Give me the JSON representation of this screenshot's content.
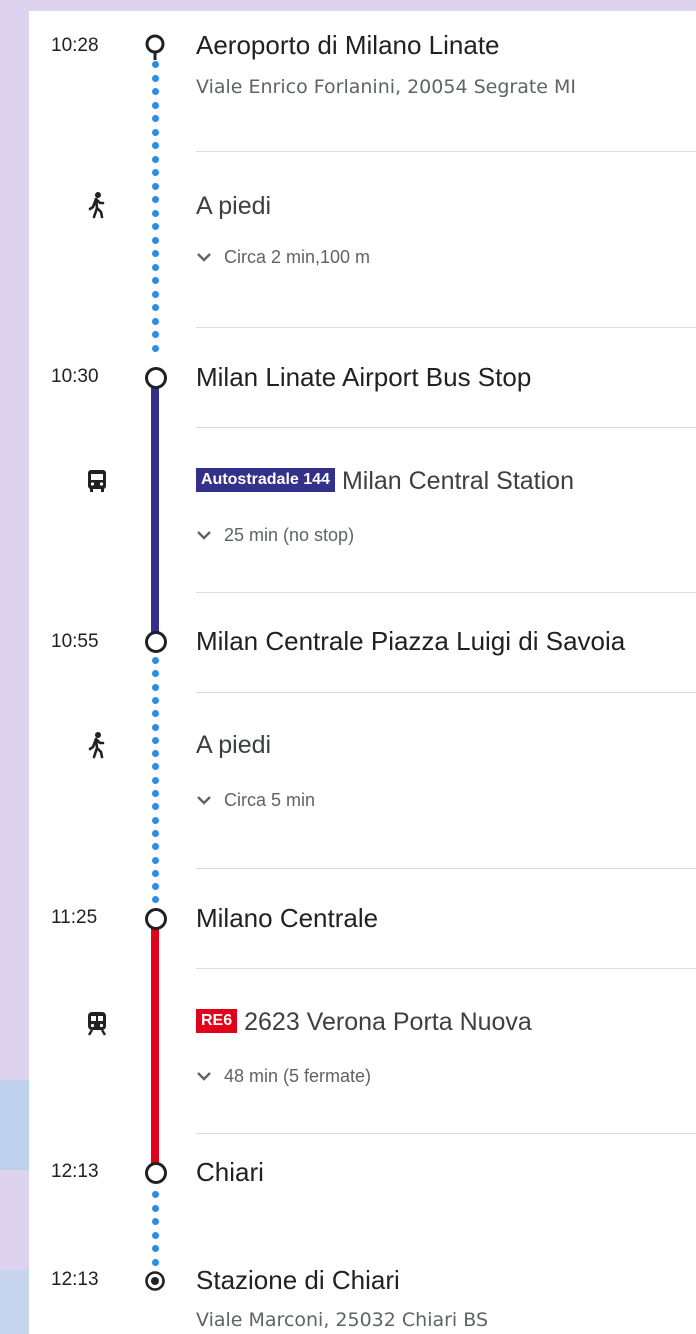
{
  "colors": {
    "walk_dots": "#2b8ce6",
    "bus_line": "#33318a",
    "train_line": "#e3001b",
    "bus_badge": "#33318a",
    "train_badge": "#e3001b"
  },
  "itinerary": {
    "stops": [
      {
        "time": "10:28",
        "name": "Aeroporto di Milano Linate",
        "address": "Viale Enrico Forlanini, 20054 Segrate MI"
      },
      {
        "time": "10:30",
        "name": "Milan Linate Airport Bus Stop"
      },
      {
        "time": "10:55",
        "name": "Milan Centrale Piazza Luigi di Savoia"
      },
      {
        "time": "11:25",
        "name": "Milano Centrale"
      },
      {
        "time": "12:13",
        "name": "Chiari"
      },
      {
        "time": "12:13",
        "name": "Stazione di Chiari",
        "address": "Viale Marconi, 25032 Chiari BS"
      }
    ],
    "segments": [
      {
        "mode_icon": "walk-icon",
        "label": "A piedi",
        "detail": "Circa 2 min,100 m"
      },
      {
        "mode_icon": "bus-icon",
        "badge": "Autostradale 144",
        "label": "Milan Central Station",
        "detail": "25 min (no stop)"
      },
      {
        "mode_icon": "walk-icon",
        "label": "A piedi",
        "detail": "Circa 5 min"
      },
      {
        "mode_icon": "train-icon",
        "badge": "RE6",
        "label": "2623 Verona Porta Nuova",
        "detail": "48 min (5 fermate)"
      }
    ]
  }
}
